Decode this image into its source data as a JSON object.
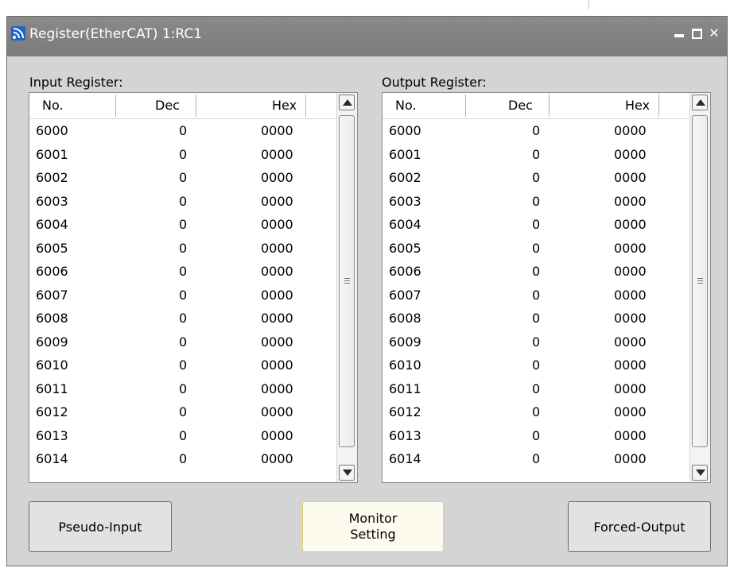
{
  "window": {
    "title": "Register(EtherCAT) 1:RC1"
  },
  "input_register": {
    "label": "Input Register:",
    "columns": [
      "No.",
      "Dec",
      "Hex"
    ],
    "rows": [
      [
        "6000",
        "0",
        "0000"
      ],
      [
        "6001",
        "0",
        "0000"
      ],
      [
        "6002",
        "0",
        "0000"
      ],
      [
        "6003",
        "0",
        "0000"
      ],
      [
        "6004",
        "0",
        "0000"
      ],
      [
        "6005",
        "0",
        "0000"
      ],
      [
        "6006",
        "0",
        "0000"
      ],
      [
        "6007",
        "0",
        "0000"
      ],
      [
        "6008",
        "0",
        "0000"
      ],
      [
        "6009",
        "0",
        "0000"
      ],
      [
        "6010",
        "0",
        "0000"
      ],
      [
        "6011",
        "0",
        "0000"
      ],
      [
        "6012",
        "0",
        "0000"
      ],
      [
        "6013",
        "0",
        "0000"
      ],
      [
        "6014",
        "0",
        "0000"
      ]
    ]
  },
  "output_register": {
    "label": "Output Register:",
    "columns": [
      "No.",
      "Dec",
      "Hex"
    ],
    "rows": [
      [
        "6000",
        "0",
        "0000"
      ],
      [
        "6001",
        "0",
        "0000"
      ],
      [
        "6002",
        "0",
        "0000"
      ],
      [
        "6003",
        "0",
        "0000"
      ],
      [
        "6004",
        "0",
        "0000"
      ],
      [
        "6005",
        "0",
        "0000"
      ],
      [
        "6006",
        "0",
        "0000"
      ],
      [
        "6007",
        "0",
        "0000"
      ],
      [
        "6008",
        "0",
        "0000"
      ],
      [
        "6009",
        "0",
        "0000"
      ],
      [
        "6010",
        "0",
        "0000"
      ],
      [
        "6011",
        "0",
        "0000"
      ],
      [
        "6012",
        "0",
        "0000"
      ],
      [
        "6013",
        "0",
        "0000"
      ],
      [
        "6014",
        "0",
        "0000"
      ]
    ]
  },
  "buttons": {
    "pseudo_input": "Pseudo-Input",
    "monitor_setting": "Monitor\nSetting",
    "forced_output": "Forced-Output"
  },
  "icons": {
    "app": "ethercat-signal-icon",
    "minimize": "minimize-icon",
    "maximize": "maximize-icon",
    "close": "close-icon"
  },
  "colors": {
    "titlebar": "#808080",
    "window_bg": "#d4d4d4",
    "app_icon": "#1e63c8",
    "highlight_border": "#e8cf6a"
  }
}
